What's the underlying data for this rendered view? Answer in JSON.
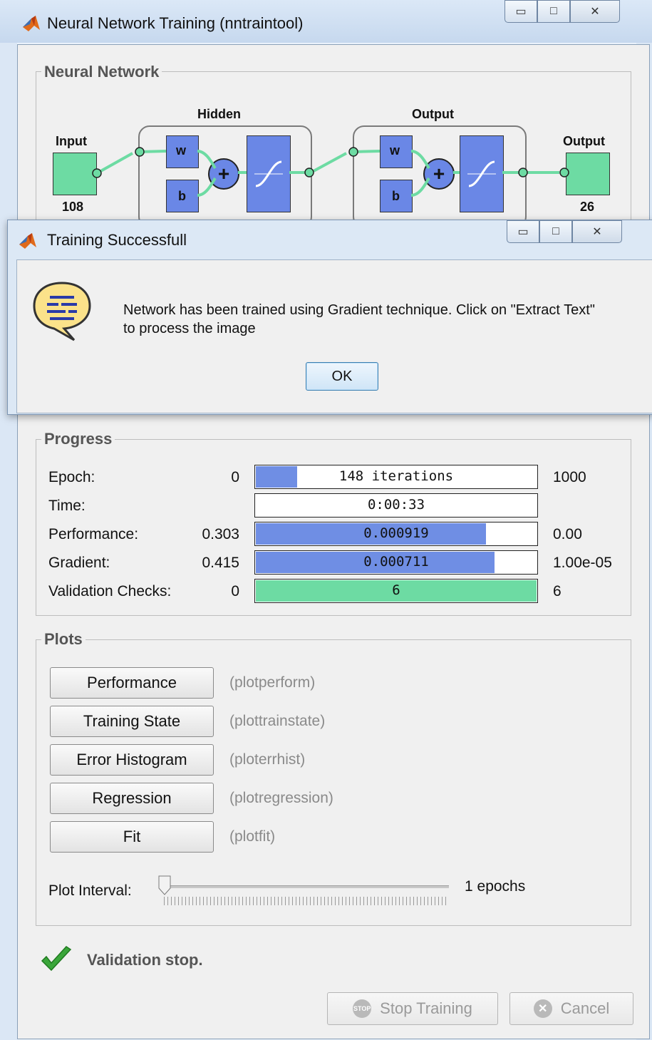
{
  "main_window": {
    "title": "Neural Network Training (nntraintool)",
    "caption_buttons": {
      "minimize": "▭",
      "maximize": "□",
      "close": "✕"
    }
  },
  "network": {
    "group_label": "Neural Network",
    "input_label": "Input",
    "input_size": "108",
    "hidden_label": "Hidden",
    "output_layer_label": "Output",
    "output_label": "Output",
    "output_size": "26",
    "weight_label": "w",
    "bias_label": "b",
    "sum_symbol": "+"
  },
  "dialog": {
    "title": "Training Successfull",
    "message_line1": "Network has been trained using Gradient technique. Click on \"Extract Text\"",
    "message_line2": "to process the image",
    "ok_label": "OK"
  },
  "progress": {
    "group_label": "Progress",
    "rows": [
      {
        "label": "Epoch:",
        "min": "0",
        "bar_text": "148 iterations",
        "max": "1000",
        "fill": 0.148,
        "color": "#6f8ee4"
      },
      {
        "label": "Time:",
        "min": "",
        "bar_text": "0:00:33",
        "max": "",
        "fill": 0,
        "color": "#6f8ee4"
      },
      {
        "label": "Performance:",
        "min": "0.303",
        "bar_text": "0.000919",
        "max": "0.00",
        "fill": 0.82,
        "color": "#6f8ee4"
      },
      {
        "label": "Gradient:",
        "min": "0.415",
        "bar_text": "0.000711",
        "max": "1.00e-05",
        "fill": 0.85,
        "color": "#6f8ee4"
      },
      {
        "label": "Validation Checks:",
        "min": "0",
        "bar_text": "6",
        "max": "6",
        "fill": 1.0,
        "color": "#6ddba3"
      }
    ]
  },
  "plots": {
    "group_label": "Plots",
    "buttons": [
      {
        "label": "Performance",
        "fn": "(plotperform)"
      },
      {
        "label": "Training State",
        "fn": "(plottrainstate)"
      },
      {
        "label": "Error Histogram",
        "fn": "(ploterrhist)"
      },
      {
        "label": "Regression",
        "fn": "(plotregression)"
      },
      {
        "label": "Fit",
        "fn": "(plotfit)"
      }
    ],
    "interval_label": "Plot Interval:",
    "interval_value": "1 epochs",
    "interval_position": 0
  },
  "status": {
    "text": "Validation stop."
  },
  "footer": {
    "stop_label": "Stop Training",
    "stop_icon_text": "STOP",
    "cancel_label": "Cancel"
  },
  "colors": {
    "blue_block": "#6a87e6",
    "green_block": "#6ddba3",
    "check_green": "#3aa63a"
  }
}
